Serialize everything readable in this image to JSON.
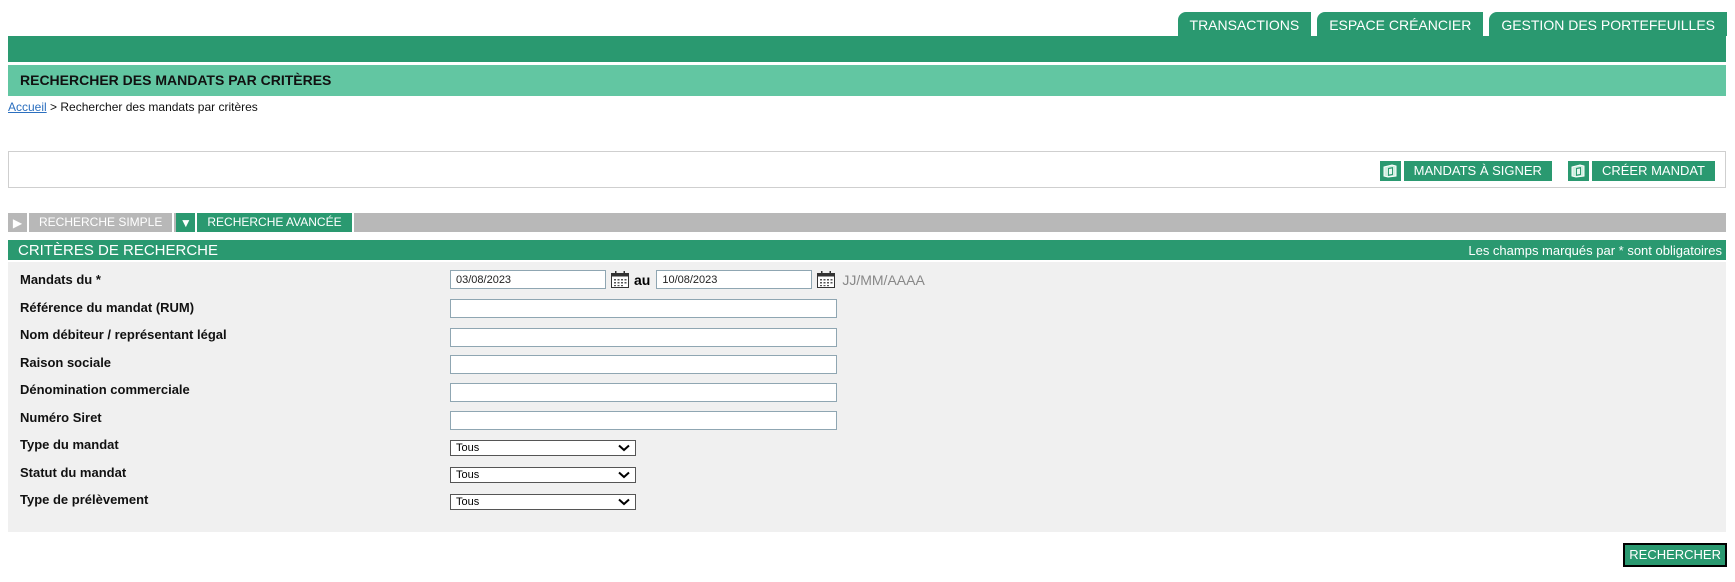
{
  "top_nav": {
    "tabs": [
      {
        "label": "TRANSACTIONS"
      },
      {
        "label": "ESPACE CRÉANCIER"
      },
      {
        "label": "GESTION DES PORTEFEUILLES"
      }
    ]
  },
  "page": {
    "title": "RECHERCHER DES MANDATS PAR CRITÈRES"
  },
  "breadcrumb": {
    "home": "Accueil",
    "separator": " > ",
    "current": "Rechercher des mandats par critères"
  },
  "actions": {
    "sign_mandates": {
      "label": "MANDATS À SIGNER",
      "icon": "document-icon"
    },
    "create_mandate": {
      "label": "CRÉER MANDAT",
      "icon": "document-icon"
    }
  },
  "search_tabs": {
    "simple": {
      "label": "RECHERCHE SIMPLE",
      "icon": "triangle-right-icon"
    },
    "advanced": {
      "label": "RECHERCHE AVANCÉE",
      "icon": "triangle-down-icon"
    }
  },
  "criteria": {
    "title": "CRITÈRES DE RECHERCHE",
    "required_note": "Les champs marqués par * sont obligatoires",
    "date_range": {
      "label": "Mandats du *",
      "from": "03/08/2023",
      "separator": "au",
      "to": "10/08/2023",
      "format_hint": "JJ/MM/AAAA"
    },
    "text_fields": [
      {
        "label": "Référence du mandat (RUM)",
        "value": ""
      },
      {
        "label": "Nom débiteur / représentant légal",
        "value": ""
      },
      {
        "label": "Raison sociale",
        "value": ""
      },
      {
        "label": "Dénomination commerciale",
        "value": ""
      },
      {
        "label": "Numéro Siret",
        "value": ""
      }
    ],
    "selects": [
      {
        "label": "Type du mandat",
        "value": "Tous"
      },
      {
        "label": "Statut du mandat",
        "value": "Tous"
      },
      {
        "label": "Type de prélèvement",
        "value": "Tous"
      }
    ]
  },
  "search_button": {
    "label": "RECHERCHER"
  },
  "colors": {
    "primary_green": "#2a9970",
    "light_green": "#62c6a2",
    "tab_gray": "#b8b8b8",
    "panel_bg": "#f0f0f0",
    "link_blue": "#2b6fbf"
  }
}
